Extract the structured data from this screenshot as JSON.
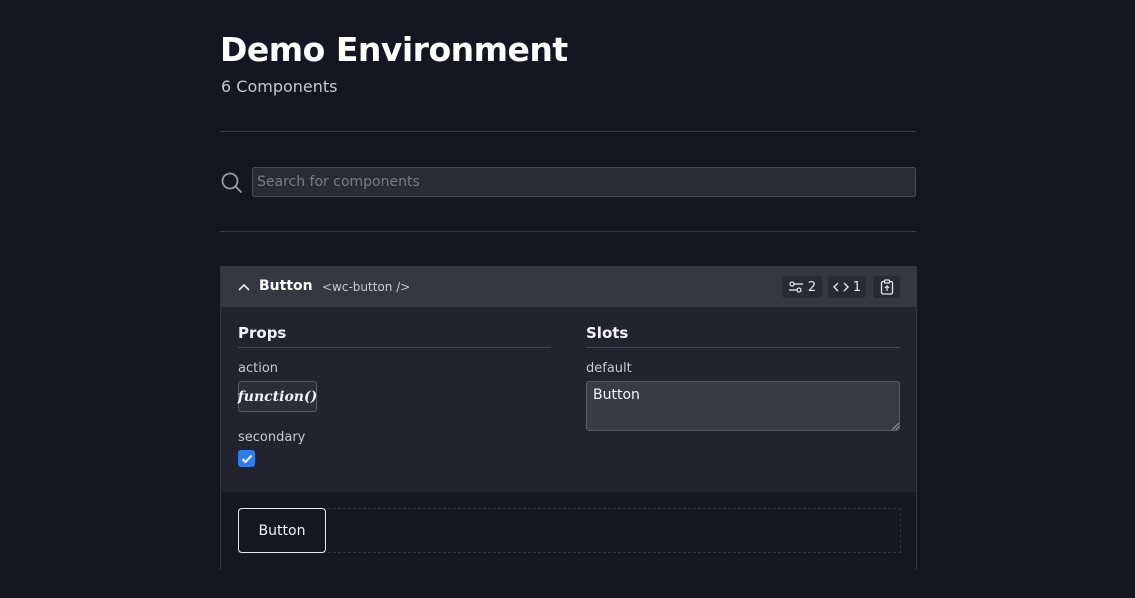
{
  "header": {
    "title": "Demo Environment",
    "subtitle": "6 Components"
  },
  "search": {
    "placeholder": "Search for components",
    "value": "",
    "icon": "search-icon"
  },
  "component": {
    "name": "Button",
    "tag": "<wc-button />",
    "expanded": true,
    "props_count": "2",
    "code_count": "1",
    "sections": {
      "props_title": "Props",
      "slots_title": "Slots"
    },
    "props": [
      {
        "name": "action",
        "value": "function()"
      },
      {
        "name": "secondary",
        "checked": true
      }
    ],
    "slots": [
      {
        "name": "default",
        "value": "Button"
      }
    ],
    "preview_button_label": "Button"
  },
  "colors": {
    "background": "#161622",
    "header_bar": "#373742",
    "checkbox": "#2f7dea"
  }
}
